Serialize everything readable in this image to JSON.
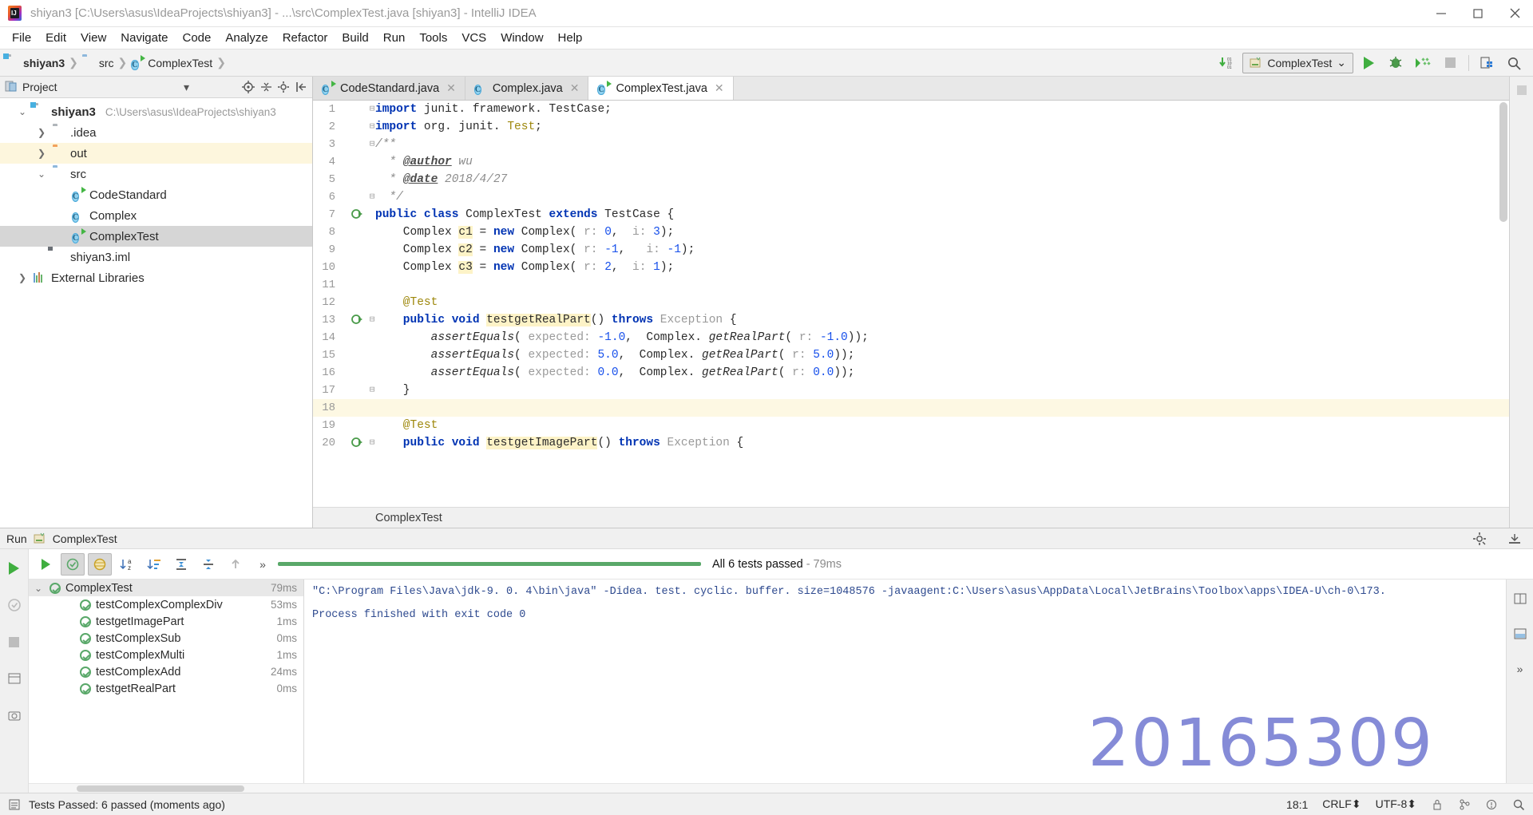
{
  "window": {
    "title": "shiyan3 [C:\\Users\\asus\\IdeaProjects\\shiyan3] - ...\\src\\ComplexTest.java [shiyan3] - IntelliJ IDEA",
    "app_icon": "intellij-idea-icon",
    "controls": {
      "minimize": "minimize-icon",
      "maximize": "maximize-icon",
      "close": "close-icon"
    }
  },
  "menubar": {
    "items": [
      "File",
      "Edit",
      "View",
      "Navigate",
      "Code",
      "Analyze",
      "Refactor",
      "Build",
      "Run",
      "Tools",
      "VCS",
      "Window",
      "Help"
    ]
  },
  "navbar": {
    "breadcrumbs": [
      {
        "label": "shiyan3",
        "icon": "module-folder-icon"
      },
      {
        "label": "src",
        "icon": "source-folder-icon"
      },
      {
        "label": "ComplexTest",
        "icon": "java-test-class-icon"
      }
    ],
    "run_config": {
      "label": "ComplexTest",
      "icon": "junit-config-icon",
      "chevron": "chevron-down-icon"
    },
    "buttons": [
      "update-project-icon",
      "run-icon",
      "debug-icon",
      "run-with-coverage-icon",
      "stop-icon",
      "settings-icon",
      "search-everywhere-icon"
    ]
  },
  "project_panel": {
    "header_title": "Project",
    "header_icons": [
      "project-view-icon",
      "chevron-down-icon",
      "locate-icon",
      "collapse-all-icon",
      "settings-icon",
      "hide-icon"
    ],
    "tree": [
      {
        "label": "shiyan3",
        "path": "C:\\Users\\asus\\IdeaProjects\\shiyan3",
        "icon": "module-folder-icon",
        "expanded": true,
        "depth": 0,
        "bold": true,
        "state": "normal"
      },
      {
        "label": ".idea",
        "path": "",
        "icon": "folder-gray-icon",
        "expanded": false,
        "depth": 1,
        "bold": false,
        "state": "normal"
      },
      {
        "label": "out",
        "path": "",
        "icon": "folder-orange-icon",
        "expanded": false,
        "depth": 1,
        "bold": false,
        "state": "highlight"
      },
      {
        "label": "src",
        "path": "",
        "icon": "source-folder-icon",
        "expanded": true,
        "depth": 1,
        "bold": false,
        "state": "normal"
      },
      {
        "label": "CodeStandard",
        "path": "",
        "icon": "java-runnable-class-icon",
        "expanded": null,
        "depth": 2,
        "bold": false,
        "state": "normal"
      },
      {
        "label": "Complex",
        "path": "",
        "icon": "java-class-icon",
        "expanded": null,
        "depth": 2,
        "bold": false,
        "state": "normal"
      },
      {
        "label": "ComplexTest",
        "path": "",
        "icon": "java-test-class-icon",
        "expanded": null,
        "depth": 2,
        "bold": false,
        "state": "selected"
      },
      {
        "label": "shiyan3.iml",
        "path": "",
        "icon": "iml-file-icon",
        "expanded": null,
        "depth": 1,
        "bold": false,
        "state": "normal"
      },
      {
        "label": "External Libraries",
        "path": "",
        "icon": "library-icon",
        "expanded": false,
        "depth": 0,
        "bold": false,
        "state": "normal"
      }
    ]
  },
  "editor": {
    "tabs": [
      {
        "label": "CodeStandard.java",
        "icon": "java-runnable-class-icon",
        "active": false,
        "close": "close-icon"
      },
      {
        "label": "Complex.java",
        "icon": "java-class-icon",
        "active": false,
        "close": "close-icon"
      },
      {
        "label": "ComplexTest.java",
        "icon": "java-test-class-icon",
        "active": true,
        "close": "close-icon"
      }
    ],
    "breadcrumb": "ComplexTest",
    "lines": [
      {
        "n": "1",
        "gutter": "",
        "fold": "-",
        "highlight": false,
        "tokens": [
          {
            "t": "import ",
            "c": "kw"
          },
          {
            "t": "junit. framework. TestCase;",
            "c": ""
          }
        ]
      },
      {
        "n": "2",
        "gutter": "",
        "fold": "-",
        "highlight": false,
        "tokens": [
          {
            "t": "import ",
            "c": "kw"
          },
          {
            "t": "org. junit. ",
            "c": ""
          },
          {
            "t": "Test",
            "c": "anno"
          },
          {
            "t": ";",
            "c": ""
          }
        ]
      },
      {
        "n": "3",
        "gutter": "",
        "fold": "-",
        "highlight": false,
        "tokens": [
          {
            "t": "/**",
            "c": "cmt"
          }
        ]
      },
      {
        "n": "4",
        "gutter": "",
        "fold": "",
        "highlight": false,
        "tokens": [
          {
            "t": "  * ",
            "c": "cmt"
          },
          {
            "t": "@author",
            "c": "doctag"
          },
          {
            "t": " wu",
            "c": "cmt"
          }
        ]
      },
      {
        "n": "5",
        "gutter": "",
        "fold": "",
        "highlight": false,
        "tokens": [
          {
            "t": "  * ",
            "c": "cmt"
          },
          {
            "t": "@date",
            "c": "doctag"
          },
          {
            "t": " 2018/4/27",
            "c": "cmt"
          }
        ]
      },
      {
        "n": "6",
        "gutter": "",
        "fold": "-",
        "highlight": false,
        "tokens": [
          {
            "t": "  */",
            "c": "cmt"
          }
        ]
      },
      {
        "n": "7",
        "gutter": "run",
        "fold": "",
        "highlight": false,
        "tokens": [
          {
            "t": "public class ",
            "c": "kw"
          },
          {
            "t": "ComplexTest ",
            "c": ""
          },
          {
            "t": "extends ",
            "c": "kw"
          },
          {
            "t": "TestCase {",
            "c": ""
          }
        ]
      },
      {
        "n": "8",
        "gutter": "",
        "fold": "",
        "highlight": false,
        "tokens": [
          {
            "t": "    Complex ",
            "c": ""
          },
          {
            "t": "c1",
            "c": "field"
          },
          {
            "t": " = ",
            "c": ""
          },
          {
            "t": "new ",
            "c": "kw"
          },
          {
            "t": "Complex( ",
            "c": ""
          },
          {
            "t": "r:",
            "c": "hint"
          },
          {
            "t": " ",
            "c": ""
          },
          {
            "t": "0",
            "c": "num"
          },
          {
            "t": ",  ",
            "c": ""
          },
          {
            "t": "i:",
            "c": "hint"
          },
          {
            "t": " ",
            "c": ""
          },
          {
            "t": "3",
            "c": "num"
          },
          {
            "t": ");",
            "c": ""
          }
        ]
      },
      {
        "n": "9",
        "gutter": "",
        "fold": "",
        "highlight": false,
        "tokens": [
          {
            "t": "    Complex ",
            "c": ""
          },
          {
            "t": "c2",
            "c": "field"
          },
          {
            "t": " = ",
            "c": ""
          },
          {
            "t": "new ",
            "c": "kw"
          },
          {
            "t": "Complex( ",
            "c": ""
          },
          {
            "t": "r:",
            "c": "hint"
          },
          {
            "t": " ",
            "c": ""
          },
          {
            "t": "-1",
            "c": "num"
          },
          {
            "t": ",   ",
            "c": ""
          },
          {
            "t": "i:",
            "c": "hint"
          },
          {
            "t": " ",
            "c": ""
          },
          {
            "t": "-1",
            "c": "num"
          },
          {
            "t": ");",
            "c": ""
          }
        ]
      },
      {
        "n": "10",
        "gutter": "",
        "fold": "",
        "highlight": false,
        "tokens": [
          {
            "t": "    Complex ",
            "c": ""
          },
          {
            "t": "c3",
            "c": "field"
          },
          {
            "t": " = ",
            "c": ""
          },
          {
            "t": "new ",
            "c": "kw"
          },
          {
            "t": "Complex( ",
            "c": ""
          },
          {
            "t": "r:",
            "c": "hint"
          },
          {
            "t": " ",
            "c": ""
          },
          {
            "t": "2",
            "c": "num"
          },
          {
            "t": ",  ",
            "c": ""
          },
          {
            "t": "i:",
            "c": "hint"
          },
          {
            "t": " ",
            "c": ""
          },
          {
            "t": "1",
            "c": "num"
          },
          {
            "t": ");",
            "c": ""
          }
        ]
      },
      {
        "n": "11",
        "gutter": "",
        "fold": "",
        "highlight": false,
        "tokens": []
      },
      {
        "n": "12",
        "gutter": "",
        "fold": "",
        "highlight": false,
        "tokens": [
          {
            "t": "    @Test",
            "c": "anno"
          }
        ]
      },
      {
        "n": "13",
        "gutter": "run",
        "fold": "-",
        "highlight": false,
        "tokens": [
          {
            "t": "    public void ",
            "c": "kw"
          },
          {
            "t": "testgetRealPart",
            "c": "mname"
          },
          {
            "t": "() ",
            "c": ""
          },
          {
            "t": "throws ",
            "c": "kw"
          },
          {
            "t": "Exception ",
            "c": "gray"
          },
          {
            "t": "{",
            "c": ""
          }
        ]
      },
      {
        "n": "14",
        "gutter": "",
        "fold": "",
        "highlight": false,
        "tokens": [
          {
            "t": "        assertEquals",
            "c": "ital"
          },
          {
            "t": "( ",
            "c": ""
          },
          {
            "t": "expected:",
            "c": "hint"
          },
          {
            "t": " ",
            "c": ""
          },
          {
            "t": "-1.0",
            "c": "num"
          },
          {
            "t": ",  Complex. ",
            "c": ""
          },
          {
            "t": "getRealPart",
            "c": "ital"
          },
          {
            "t": "( ",
            "c": ""
          },
          {
            "t": "r:",
            "c": "hint"
          },
          {
            "t": " ",
            "c": ""
          },
          {
            "t": "-1.0",
            "c": "num"
          },
          {
            "t": "));",
            "c": ""
          }
        ]
      },
      {
        "n": "15",
        "gutter": "",
        "fold": "",
        "highlight": false,
        "tokens": [
          {
            "t": "        assertEquals",
            "c": "ital"
          },
          {
            "t": "( ",
            "c": ""
          },
          {
            "t": "expected:",
            "c": "hint"
          },
          {
            "t": " ",
            "c": ""
          },
          {
            "t": "5.0",
            "c": "num"
          },
          {
            "t": ",  Complex. ",
            "c": ""
          },
          {
            "t": "getRealPart",
            "c": "ital"
          },
          {
            "t": "( ",
            "c": ""
          },
          {
            "t": "r:",
            "c": "hint"
          },
          {
            "t": " ",
            "c": ""
          },
          {
            "t": "5.0",
            "c": "num"
          },
          {
            "t": "));",
            "c": ""
          }
        ]
      },
      {
        "n": "16",
        "gutter": "",
        "fold": "",
        "highlight": false,
        "tokens": [
          {
            "t": "        assertEquals",
            "c": "ital"
          },
          {
            "t": "( ",
            "c": ""
          },
          {
            "t": "expected:",
            "c": "hint"
          },
          {
            "t": " ",
            "c": ""
          },
          {
            "t": "0.0",
            "c": "num"
          },
          {
            "t": ",  Complex. ",
            "c": ""
          },
          {
            "t": "getRealPart",
            "c": "ital"
          },
          {
            "t": "( ",
            "c": ""
          },
          {
            "t": "r:",
            "c": "hint"
          },
          {
            "t": " ",
            "c": ""
          },
          {
            "t": "0.0",
            "c": "num"
          },
          {
            "t": "));",
            "c": ""
          }
        ]
      },
      {
        "n": "17",
        "gutter": "",
        "fold": "-",
        "highlight": false,
        "tokens": [
          {
            "t": "    }",
            "c": ""
          }
        ]
      },
      {
        "n": "18",
        "gutter": "",
        "fold": "",
        "highlight": true,
        "tokens": []
      },
      {
        "n": "19",
        "gutter": "",
        "fold": "",
        "highlight": false,
        "tokens": [
          {
            "t": "    @Test",
            "c": "anno"
          }
        ]
      },
      {
        "n": "20",
        "gutter": "run",
        "fold": "-",
        "highlight": false,
        "tokens": [
          {
            "t": "    public void ",
            "c": "kw"
          },
          {
            "t": "testgetImagePart",
            "c": "mname"
          },
          {
            "t": "() ",
            "c": ""
          },
          {
            "t": "throws ",
            "c": "kw"
          },
          {
            "t": "Exception ",
            "c": "gray"
          },
          {
            "t": "{",
            "c": ""
          }
        ]
      }
    ]
  },
  "run_panel": {
    "tool_window_title": "Run",
    "config_name": "ComplexTest",
    "config_icon": "junit-config-icon",
    "toolbar_left": [
      "rerun-icon",
      "rerun-failed-icon",
      "stop-icon",
      "dump-threads-icon",
      "screenshot-icon"
    ],
    "toolbar_top": [
      "rerun-tests-icon",
      "show-passed-icon",
      "show-ignored-icon",
      "sort-alphabetically-icon",
      "sort-by-duration-icon",
      "expand-all-icon",
      "collapse-all-icon",
      "prev-failed-icon",
      "more-icon"
    ],
    "status_text": "All 6 tests passed",
    "status_time": "- 79ms",
    "progress_color": "#59a869",
    "tests": [
      {
        "label": "ComplexTest",
        "duration": "79ms",
        "status": "passed",
        "depth": 0,
        "selected": true,
        "expanded": true
      },
      {
        "label": "testComplexComplexDiv",
        "duration": "53ms",
        "status": "passed",
        "depth": 1,
        "selected": false,
        "expanded": null
      },
      {
        "label": "testgetImagePart",
        "duration": "1ms",
        "status": "passed",
        "depth": 1,
        "selected": false,
        "expanded": null
      },
      {
        "label": "testComplexSub",
        "duration": "0ms",
        "status": "passed",
        "depth": 1,
        "selected": false,
        "expanded": null
      },
      {
        "label": "testComplexMulti",
        "duration": "1ms",
        "status": "passed",
        "depth": 1,
        "selected": false,
        "expanded": null
      },
      {
        "label": "testComplexAdd",
        "duration": "24ms",
        "status": "passed",
        "depth": 1,
        "selected": false,
        "expanded": null
      },
      {
        "label": "testgetRealPart",
        "duration": "0ms",
        "status": "passed",
        "depth": 1,
        "selected": false,
        "expanded": null
      }
    ],
    "console": {
      "line1": "\"C:\\Program Files\\Java\\jdk-9. 0. 4\\bin\\java\" -Didea. test. cyclic. buffer. size=1048576 -javaagent:C:\\Users\\asus\\AppData\\Local\\JetBrains\\Toolbox\\apps\\IDEA-U\\ch-0\\173.",
      "line2": "Process finished with exit code 0",
      "watermark": "20165309"
    },
    "right_icons": [
      "settings-icon",
      "hide-icon",
      "pin-icon",
      "layout-icon",
      "collapse-icon",
      "more-icon"
    ]
  },
  "statusbar": {
    "message": "Tests Passed: 6 passed (moments ago)",
    "caret": "18:1",
    "line_separator": "CRLF⬍",
    "encoding": "UTF-8⬍",
    "icons": [
      "event-log-icon",
      "lock-icon",
      "git-branch-icon",
      "inspection-icon",
      "search-icon"
    ]
  }
}
